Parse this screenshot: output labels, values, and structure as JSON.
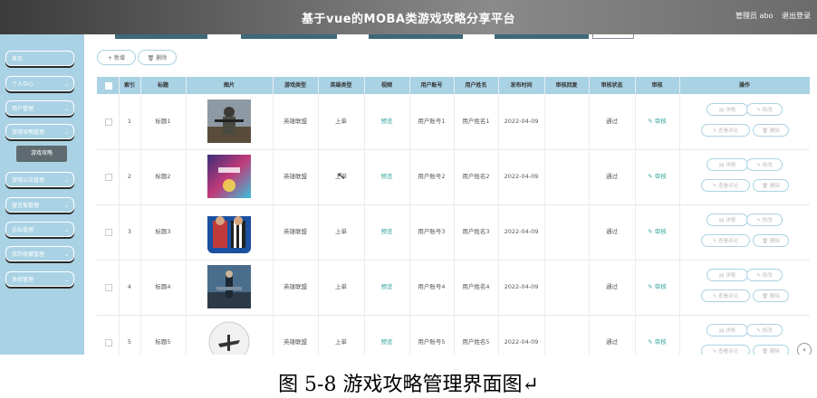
{
  "header": {
    "title": "基于vue的MOBA类游戏攻略分享平台",
    "admin": "管理员 abo",
    "logout": "退出登录"
  },
  "sidebar": {
    "items": [
      {
        "label": "首页",
        "chevron": false
      },
      {
        "label": "个人中心",
        "chevron": true
      },
      {
        "label": "用户管理",
        "chevron": true
      },
      {
        "label": "游戏攻略管理",
        "chevron": true
      },
      {
        "label": "游戏公告管理",
        "chevron": true
      },
      {
        "label": "留言板管理",
        "chevron": true
      },
      {
        "label": "论坛管理",
        "chevron": true
      },
      {
        "label": "我的收藏管理",
        "chevron": true
      },
      {
        "label": "系统管理",
        "chevron": true
      }
    ],
    "sub_item": "游戏攻略"
  },
  "toolbar": {
    "add": "+ 新增",
    "delete": "🗑 删除"
  },
  "table": {
    "columns": [
      "索引",
      "标题",
      "图片",
      "游戏类型",
      "英雄类型",
      "视频",
      "用户账号",
      "用户姓名",
      "发布时间",
      "审核回复",
      "审核状态",
      "审核",
      "操作"
    ],
    "rows": [
      {
        "index": "1",
        "title": "标题1",
        "game_type": "英雄联盟",
        "hero_type": "上单",
        "video": "预览",
        "account": "用户账号1",
        "name": "用户姓名1",
        "time": "2022-04-09",
        "reply": "",
        "status": "通过",
        "audit": "✎ 审核"
      },
      {
        "index": "2",
        "title": "标题2",
        "game_type": "英雄联盟",
        "hero_type": "上单",
        "video": "预览",
        "account": "用户账号2",
        "name": "用户姓名2",
        "time": "2022-04-09",
        "reply": "",
        "status": "通过",
        "audit": "✎ 审核"
      },
      {
        "index": "3",
        "title": "标题3",
        "game_type": "英雄联盟",
        "hero_type": "上单",
        "video": "预览",
        "account": "用户账号3",
        "name": "用户姓名3",
        "time": "2022-04-09",
        "reply": "",
        "status": "通过",
        "audit": "✎ 审核"
      },
      {
        "index": "4",
        "title": "标题4",
        "game_type": "英雄联盟",
        "hero_type": "上单",
        "video": "预览",
        "account": "用户账号4",
        "name": "用户姓名4",
        "time": "2022-04-09",
        "reply": "",
        "status": "通过",
        "audit": "✎ 审核"
      },
      {
        "index": "5",
        "title": "标题5",
        "game_type": "英雄联盟",
        "hero_type": "上单",
        "video": "预览",
        "account": "用户账号5",
        "name": "用户姓名5",
        "time": "2022-04-09",
        "reply": "",
        "status": "通过",
        "audit": "✎ 审核"
      }
    ],
    "actions": {
      "detail": "▤ 详情",
      "edit": "✎ 修改",
      "comments": "✎ 查看评论",
      "delete": "🗑 删除"
    }
  },
  "caption": "图 5-8 游戏攻略管理界面图↵",
  "colors": {
    "accent": "#a9d2e4",
    "header": "#6a6a6a",
    "link": "#3aa6a0"
  }
}
